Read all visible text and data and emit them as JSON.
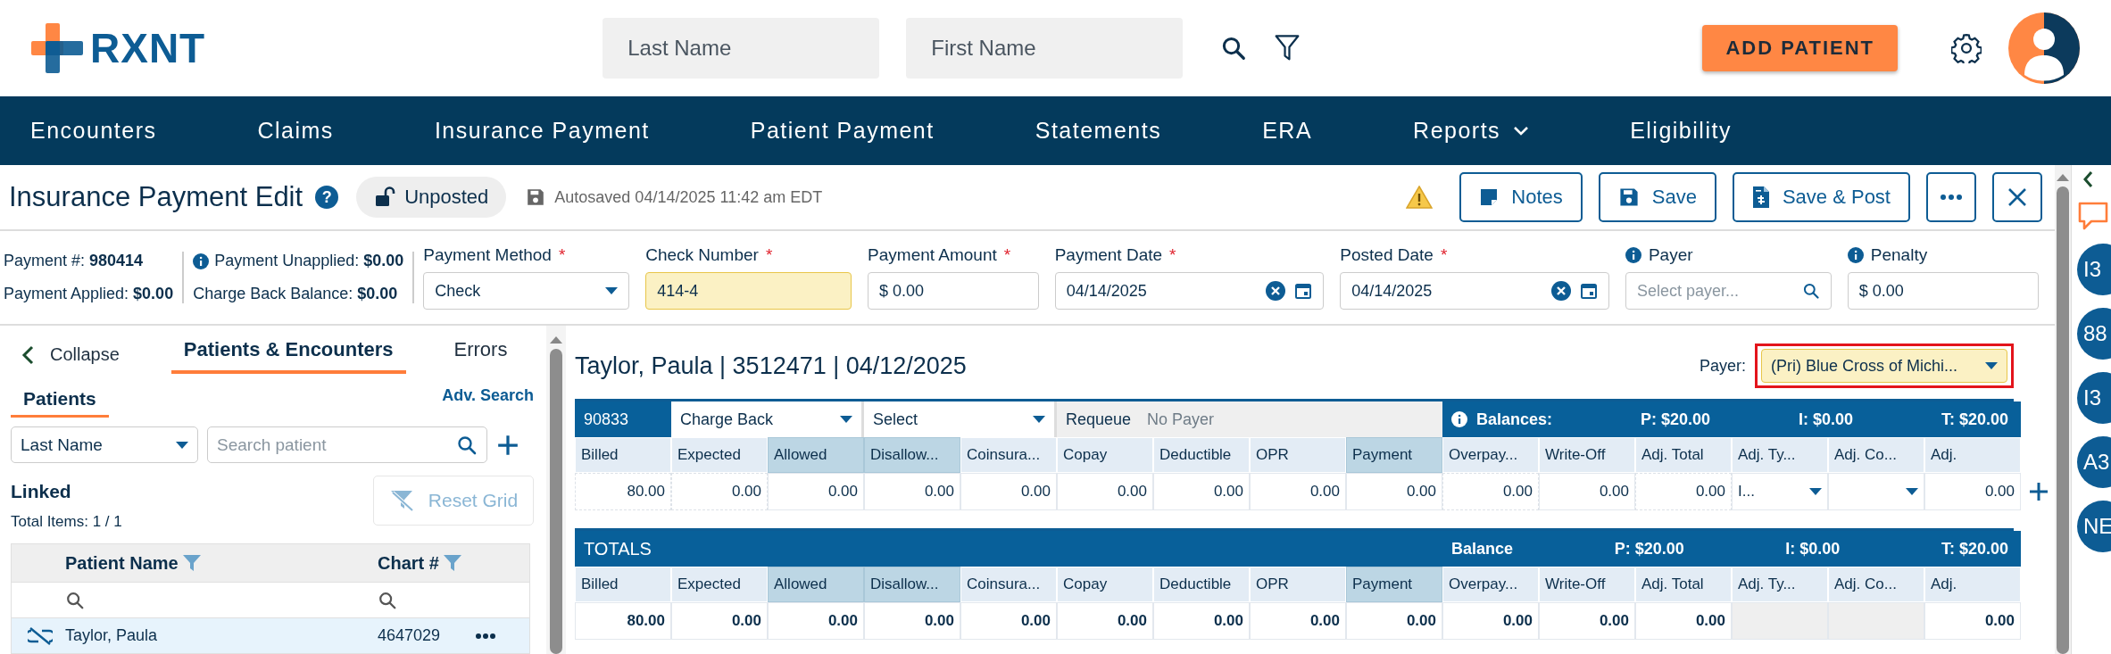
{
  "header": {
    "logo": "RXNT",
    "search_fields": [
      {
        "placeholder": "Last Name"
      },
      {
        "placeholder": "First Name"
      }
    ],
    "add_button": "ADD PATIENT"
  },
  "nav": [
    {
      "label": "Encounters",
      "kind": "link"
    },
    {
      "label": "Claims",
      "kind": "link"
    },
    {
      "label": "Insurance Payment",
      "kind": "link"
    },
    {
      "label": "Patient Payment",
      "kind": "link"
    },
    {
      "label": "Statements",
      "kind": "link"
    },
    {
      "label": "ERA",
      "kind": "link"
    },
    {
      "label": "Reports",
      "kind": "dropdown"
    },
    {
      "label": "Eligibility",
      "kind": "link"
    }
  ],
  "page": {
    "title": "Insurance Payment Edit",
    "help": "?",
    "status": "Unposted",
    "autosaved": "Autosaved 04/14/2025 11:42 am EDT",
    "actions": [
      {
        "kind": "notes",
        "label": "Notes"
      },
      {
        "kind": "save",
        "label": "Save"
      },
      {
        "kind": "post",
        "label": "Save & Post"
      },
      {
        "kind": "more"
      },
      {
        "kind": "close"
      }
    ]
  },
  "summary": [
    [
      {
        "label": "Payment #:",
        "value": "980414",
        "info": false
      },
      {
        "label": "Payment Applied:",
        "value": "$0.00",
        "info": false
      }
    ],
    [
      {
        "label": "Payment Unapplied:",
        "value": "$0.00",
        "info": true
      },
      {
        "label": "Charge Back Balance:",
        "value": "$0.00",
        "info": false
      }
    ]
  ],
  "fields": [
    {
      "label": "Payment Method",
      "required_mark": "*",
      "info": false,
      "kind": "select",
      "value": "Check",
      "highlighted": false
    },
    {
      "label": "Check Number",
      "required_mark": "*",
      "info": false,
      "kind": "text",
      "value": "414-4",
      "highlighted": true
    },
    {
      "label": "Payment Amount",
      "required_mark": "*",
      "info": false,
      "kind": "text",
      "value": "$ 0.00",
      "highlighted": false
    },
    {
      "label": "Payment Date",
      "required_mark": "*",
      "info": false,
      "kind": "date",
      "value": "04/14/2025",
      "highlighted": false
    },
    {
      "label": "Posted Date",
      "required_mark": "*",
      "info": false,
      "kind": "date",
      "value": "04/14/2025",
      "highlighted": false
    },
    {
      "label": "Payer",
      "info": true,
      "kind": "search",
      "placeholder": "Select payer...",
      "highlighted": false
    },
    {
      "label": "Penalty",
      "info": true,
      "kind": "text",
      "value": "$ 0.00",
      "highlighted": false
    }
  ],
  "left_panel": {
    "collapse": "Collapse",
    "tabs": [
      {
        "label": "Patients & Encounters",
        "selected": true
      },
      {
        "label": "Errors",
        "selected": false
      }
    ],
    "subtabs": [
      {
        "label": "Patients",
        "selected": true
      }
    ],
    "adv_search": "Adv. Search",
    "search_by": "Last Name",
    "search": {
      "placeholder": "Search patient"
    },
    "linked_title": "Linked",
    "total_items": "Total Items: 1 / 1",
    "reset_grid": {
      "label": "Reset Grid",
      "disabled": true
    },
    "columns": [
      "Patient Name",
      "Chart #"
    ],
    "rows": [
      {
        "name": "Taylor, Paula",
        "chart": "4647029",
        "selected": true
      }
    ]
  },
  "main": {
    "encounter_title": "Taylor, Paula | 3512471 | 04/12/2025",
    "payer_label": "Payer:",
    "payer_value": "(Pri) Blue Cross of Michi...",
    "payer_flagged": true,
    "line": {
      "code": "90833",
      "adjustment": "Charge Back",
      "reason": "Select",
      "requeue_label": "Requeue",
      "requeue_value": "No Payer",
      "balances_label": "Balances:",
      "balances": [
        "P: $20.00",
        "I: $0.00",
        "T: $20.00"
      ],
      "columns": [
        {
          "label": "Billed",
          "emphasis": false
        },
        {
          "label": "Expected",
          "emphasis": false
        },
        {
          "label": "Allowed",
          "emphasis": true
        },
        {
          "label": "Disallow...",
          "emphasis": true
        },
        {
          "label": "Coinsura...",
          "emphasis": false
        },
        {
          "label": "Copay",
          "emphasis": false
        },
        {
          "label": "Deductible",
          "emphasis": false
        },
        {
          "label": "OPR",
          "emphasis": false
        },
        {
          "label": "Payment",
          "emphasis": true
        },
        {
          "label": "Overpay...",
          "emphasis": false
        },
        {
          "label": "Write-Off",
          "emphasis": false
        },
        {
          "label": "Adj. Total",
          "emphasis": false
        },
        {
          "label": "Adj. Ty...",
          "emphasis": false
        },
        {
          "label": "Adj. Co...",
          "emphasis": false
        },
        {
          "label": "Adj.",
          "emphasis": false
        }
      ],
      "cells": [
        {
          "kind": "readonly",
          "text": "80.00"
        },
        {
          "kind": "readonly",
          "text": "0.00"
        },
        {
          "kind": "value",
          "text": "0.00"
        },
        {
          "kind": "value",
          "text": "0.00"
        },
        {
          "kind": "value",
          "text": "0.00"
        },
        {
          "kind": "value",
          "text": "0.00"
        },
        {
          "kind": "value",
          "text": "0.00"
        },
        {
          "kind": "value",
          "text": "0.00"
        },
        {
          "kind": "value",
          "text": "0.00"
        },
        {
          "kind": "readonly",
          "text": "0.00"
        },
        {
          "kind": "value",
          "text": "0.00"
        },
        {
          "kind": "readonly",
          "text": "0.00"
        },
        {
          "kind": "select",
          "text": "I..."
        },
        {
          "kind": "select"
        },
        {
          "kind": "value",
          "text": "0.00"
        }
      ]
    },
    "totals": {
      "title": "TOTALS",
      "balance_label": "Balance",
      "balances": [
        "P: $20.00",
        "I: $0.00",
        "T: $20.00"
      ],
      "columns": [
        {
          "label": "Billed",
          "emphasis": false
        },
        {
          "label": "Expected",
          "emphasis": false
        },
        {
          "label": "Allowed",
          "emphasis": true
        },
        {
          "label": "Disallow...",
          "emphasis": true
        },
        {
          "label": "Coinsura...",
          "emphasis": false
        },
        {
          "label": "Copay",
          "emphasis": false
        },
        {
          "label": "Deductible",
          "emphasis": false
        },
        {
          "label": "OPR",
          "emphasis": false
        },
        {
          "label": "Payment",
          "emphasis": true
        },
        {
          "label": "Overpay...",
          "emphasis": false
        },
        {
          "label": "Write-Off",
          "emphasis": false
        },
        {
          "label": "Adj. Total",
          "emphasis": false
        },
        {
          "label": "Adj. Ty...",
          "emphasis": false
        },
        {
          "label": "Adj. Co...",
          "emphasis": false
        },
        {
          "label": "Adj.",
          "emphasis": false
        }
      ],
      "cells": [
        {
          "kind": "value",
          "text": "80.00"
        },
        {
          "kind": "value",
          "text": "0.00"
        },
        {
          "kind": "value",
          "text": "0.00"
        },
        {
          "kind": "value",
          "text": "0.00"
        },
        {
          "kind": "value",
          "text": "0.00"
        },
        {
          "kind": "value",
          "text": "0.00"
        },
        {
          "kind": "value",
          "text": "0.00"
        },
        {
          "kind": "value",
          "text": "0.00"
        },
        {
          "kind": "value",
          "text": "0.00"
        },
        {
          "kind": "value",
          "text": "0.00"
        },
        {
          "kind": "value",
          "text": "0.00"
        },
        {
          "kind": "value",
          "text": "0.00"
        },
        {
          "kind": "blank"
        },
        {
          "kind": "blank"
        },
        {
          "kind": "value",
          "text": "0.00"
        }
      ]
    }
  },
  "right_sidebar": {
    "items": [
      "I3",
      "88",
      "I3",
      "A3",
      "NE"
    ]
  }
}
